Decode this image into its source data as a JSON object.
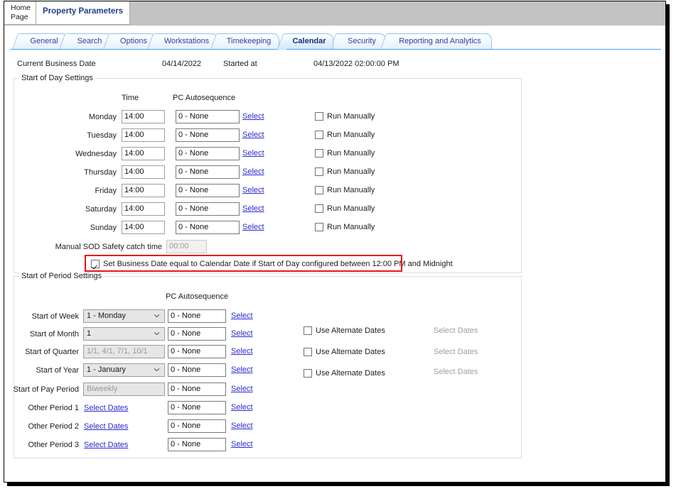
{
  "window": {
    "doc_tabs": [
      {
        "label": "Home\nPage",
        "active": false
      },
      {
        "label": "Property Parameters",
        "active": true
      }
    ]
  },
  "tabs": [
    {
      "label": "General",
      "active": false
    },
    {
      "label": "Search",
      "active": false
    },
    {
      "label": "Options",
      "active": false
    },
    {
      "label": "Workstations",
      "active": false
    },
    {
      "label": "Timekeeping",
      "active": false
    },
    {
      "label": "Calendar",
      "active": true
    },
    {
      "label": "Security",
      "active": false
    },
    {
      "label": "Reporting and Analytics",
      "active": false
    }
  ],
  "header": {
    "business_date_label": "Current Business Date",
    "business_date_value": "04/14/2022",
    "started_at_label": "Started at",
    "started_at_value": "04/13/2022  02:00:00 PM"
  },
  "start_of_day": {
    "caption": "Start of Day Settings",
    "col_time": "Time",
    "col_autosequence": "PC Autosequence",
    "rows": [
      {
        "day": "Monday",
        "time": "14:00",
        "autosequence": "0 - None",
        "select": "Select",
        "run_manually": "Run Manually",
        "checked": false
      },
      {
        "day": "Tuesday",
        "time": "14:00",
        "autosequence": "0 - None",
        "select": "Select",
        "run_manually": "Run Manually",
        "checked": false
      },
      {
        "day": "Wednesday",
        "time": "14:00",
        "autosequence": "0 - None",
        "select": "Select",
        "run_manually": "Run Manually",
        "checked": false
      },
      {
        "day": "Thursday",
        "time": "14:00",
        "autosequence": "0 - None",
        "select": "Select",
        "run_manually": "Run Manually",
        "checked": false
      },
      {
        "day": "Friday",
        "time": "14:00",
        "autosequence": "0 - None",
        "select": "Select",
        "run_manually": "Run Manually",
        "checked": false
      },
      {
        "day": "Saturday",
        "time": "14:00",
        "autosequence": "0 - None",
        "select": "Select",
        "run_manually": "Run Manually",
        "checked": false
      },
      {
        "day": "Sunday",
        "time": "14:00",
        "autosequence": "0 - None",
        "select": "Select",
        "run_manually": "Run Manually",
        "checked": false
      }
    ],
    "safety_catch_label": "Manual SOD Safety catch time",
    "safety_catch_value": "00:00",
    "business_date_equal_label": "Set Business Date equal to Calendar Date if Start of Day configured between 12:00 PM and Midnight",
    "business_date_equal_checked": true
  },
  "start_of_period": {
    "caption": "Start of Period Settings",
    "col_autosequence": "PC Autosequence",
    "rows": [
      {
        "label": "Start of Week",
        "control": "combo",
        "value": "1 - Monday",
        "autosequence": "0 - None",
        "select": "Select",
        "alt_label": "Use Alternate Dates",
        "alt_checked": false,
        "alt_link": "Select Dates",
        "has_alt": false
      },
      {
        "label": "Start of Month",
        "control": "combo",
        "value": "1",
        "autosequence": "0 - None",
        "select": "Select",
        "alt_label": "Use Alternate Dates",
        "alt_checked": false,
        "alt_link": "Select Dates",
        "has_alt": true
      },
      {
        "label": "Start of Quarter",
        "control": "text",
        "value": "1/1, 4/1, 7/1, 10/1",
        "autosequence": "0 - None",
        "select": "Select",
        "alt_label": "Use Alternate Dates",
        "alt_checked": false,
        "alt_link": "Select Dates",
        "has_alt": true
      },
      {
        "label": "Start of Year",
        "control": "combo",
        "value": "1 - January",
        "autosequence": "0 - None",
        "select": "Select",
        "alt_label": "Use Alternate Dates",
        "alt_checked": false,
        "alt_link": "Select Dates",
        "has_alt": true
      },
      {
        "label": "Start of Pay Period",
        "control": "text",
        "value": "Biweekly",
        "autosequence": "0 - None",
        "select": "Select",
        "has_alt": false
      },
      {
        "label": "Other Period 1",
        "control": "link",
        "value": "Select Dates",
        "autosequence": "0 - None",
        "select": "Select",
        "has_alt": false
      },
      {
        "label": "Other Period 2",
        "control": "link",
        "value": "Select Dates",
        "autosequence": "0 - None",
        "select": "Select",
        "has_alt": false
      },
      {
        "label": "Other Period 3",
        "control": "link",
        "value": "Select Dates",
        "autosequence": "0 - None",
        "select": "Select",
        "has_alt": false
      }
    ]
  },
  "colors": {
    "highlight": "#e81414",
    "tab_accent": "#4ea3f0",
    "link": "#2a2ad0"
  }
}
